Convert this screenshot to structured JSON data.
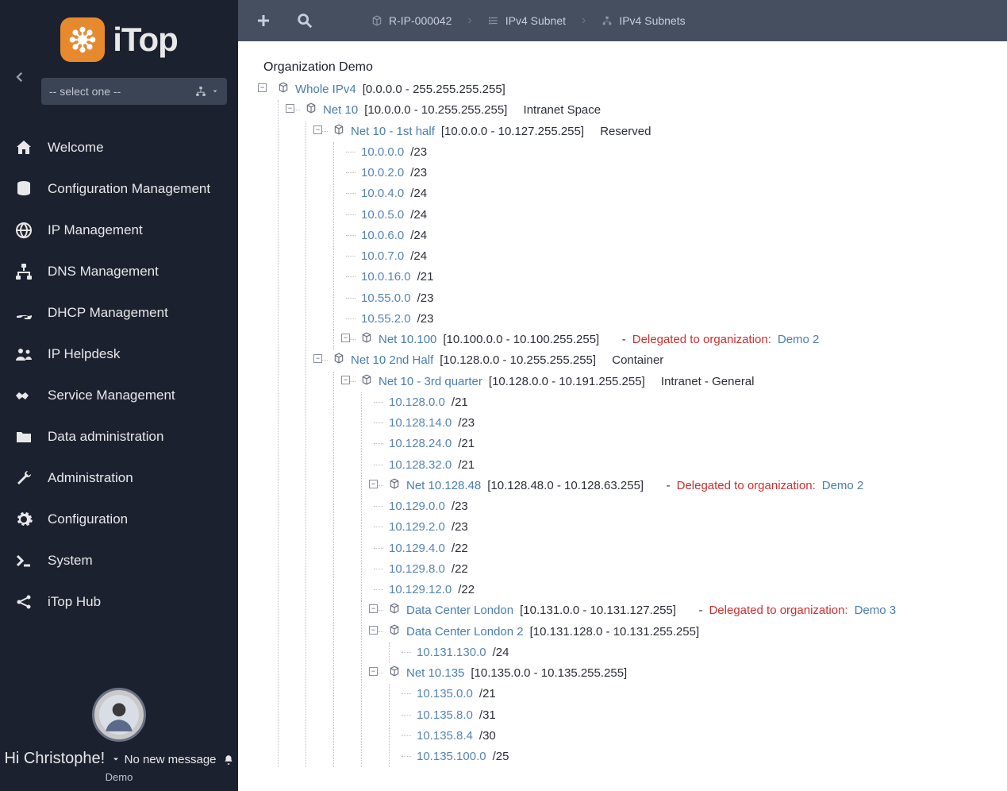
{
  "brand": {
    "name": "iTop"
  },
  "org_select": {
    "placeholder": "-- select one --"
  },
  "nav": [
    {
      "id": "welcome",
      "label": "Welcome"
    },
    {
      "id": "config-mgmt",
      "label": "Configuration Management"
    },
    {
      "id": "ip-mgmt",
      "label": "IP Management"
    },
    {
      "id": "dns-mgmt",
      "label": "DNS Management"
    },
    {
      "id": "dhcp-mgmt",
      "label": "DHCP Management"
    },
    {
      "id": "ip-helpdesk",
      "label": "IP Helpdesk"
    },
    {
      "id": "service-mgmt",
      "label": "Service Management"
    },
    {
      "id": "data-admin",
      "label": "Data administration"
    },
    {
      "id": "administration",
      "label": "Administration"
    },
    {
      "id": "configuration",
      "label": "Configuration"
    },
    {
      "id": "system",
      "label": "System"
    },
    {
      "id": "itop-hub",
      "label": "iTop Hub"
    }
  ],
  "user": {
    "greeting": "Hi Christophe!",
    "message": "No new message",
    "env": "Demo"
  },
  "breadcrumbs": [
    {
      "id": "r-ip",
      "label": "R-IP-000042"
    },
    {
      "id": "subnet",
      "label": "IPv4 Subnet"
    },
    {
      "id": "subnets",
      "label": "IPv4 Subnets"
    }
  ],
  "page": {
    "org_title": "Organization Demo",
    "delegated_label": "Delegated to organization:"
  },
  "tree": {
    "root": {
      "name": "Whole IPv4",
      "range": "[0.0.0.0 - 255.255.255.255]"
    },
    "net10": {
      "name": "Net 10",
      "range": "[10.0.0.0 - 10.255.255.255]",
      "label": "Intranet Space"
    },
    "net10_1st": {
      "name": "Net 10 - 1st half",
      "range": "[10.0.0.0 - 10.127.255.255]",
      "label": "Reserved"
    },
    "net10_1st_children": [
      {
        "ip": "10.0.0.0",
        "cidr": "/23"
      },
      {
        "ip": "10.0.2.0",
        "cidr": "/23"
      },
      {
        "ip": "10.0.4.0",
        "cidr": "/24"
      },
      {
        "ip": "10.0.5.0",
        "cidr": "/24"
      },
      {
        "ip": "10.0.6.0",
        "cidr": "/24"
      },
      {
        "ip": "10.0.7.0",
        "cidr": "/24"
      },
      {
        "ip": "10.0.16.0",
        "cidr": "/21"
      },
      {
        "ip": "10.55.0.0",
        "cidr": "/23"
      },
      {
        "ip": "10.55.2.0",
        "cidr": "/23"
      }
    ],
    "net10_100": {
      "name": "Net 10.100",
      "range": "[10.100.0.0 - 10.100.255.255]",
      "deleg_org": "Demo 2"
    },
    "net10_2nd": {
      "name": "Net 10 2nd Half",
      "range": "[10.128.0.0 - 10.255.255.255]",
      "label": "Container"
    },
    "net10_3rd": {
      "name": "Net 10 - 3rd quarter",
      "range": "[10.128.0.0 - 10.191.255.255]",
      "label": "Intranet - General"
    },
    "net10_3rd_children_a": [
      {
        "ip": "10.128.0.0",
        "cidr": "/21"
      },
      {
        "ip": "10.128.14.0",
        "cidr": "/23"
      },
      {
        "ip": "10.128.24.0",
        "cidr": "/21"
      },
      {
        "ip": "10.128.32.0",
        "cidr": "/21"
      }
    ],
    "net10_128_48": {
      "name": "Net 10.128.48",
      "range": "[10.128.48.0 - 10.128.63.255]",
      "deleg_org": "Demo 2"
    },
    "net10_3rd_children_b": [
      {
        "ip": "10.129.0.0",
        "cidr": "/23"
      },
      {
        "ip": "10.129.2.0",
        "cidr": "/23"
      },
      {
        "ip": "10.129.4.0",
        "cidr": "/22"
      },
      {
        "ip": "10.129.8.0",
        "cidr": "/22"
      },
      {
        "ip": "10.129.12.0",
        "cidr": "/22"
      }
    ],
    "dc_london": {
      "name": "Data Center London",
      "range": "[10.131.0.0 - 10.131.127.255]",
      "deleg_org": "Demo 3"
    },
    "dc_london2": {
      "name": "Data Center London 2",
      "range": "[10.131.128.0 - 10.131.255.255]"
    },
    "dc_london2_children": [
      {
        "ip": "10.131.130.0",
        "cidr": "/24"
      }
    ],
    "net10_135": {
      "name": "Net 10.135",
      "range": "[10.135.0.0 - 10.135.255.255]"
    },
    "net10_135_children": [
      {
        "ip": "10.135.0.0",
        "cidr": "/21"
      },
      {
        "ip": "10.135.8.0",
        "cidr": "/31"
      },
      {
        "ip": "10.135.8.4",
        "cidr": "/30"
      },
      {
        "ip": "10.135.100.0",
        "cidr": "/25"
      }
    ]
  }
}
